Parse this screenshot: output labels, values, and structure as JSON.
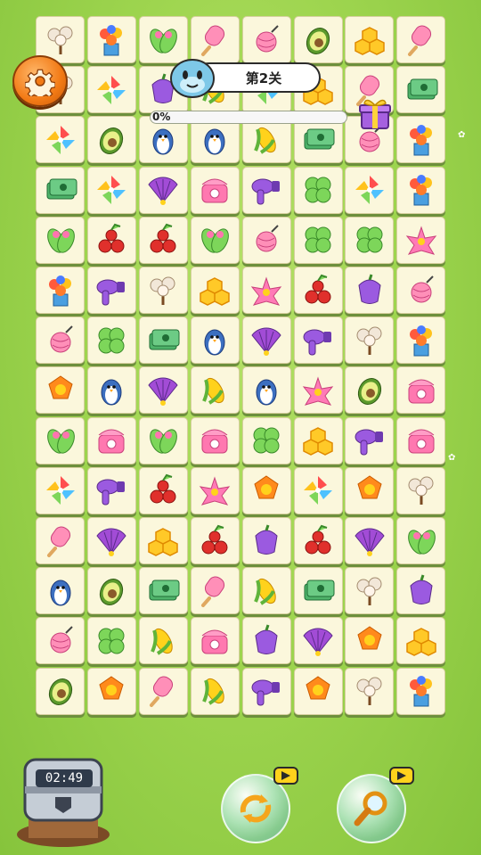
{
  "level": {
    "label": "第2关"
  },
  "progress": {
    "text": "0%",
    "value": 0
  },
  "timer": {
    "text": "02:49"
  },
  "powerups": [
    {
      "name": "shuffle",
      "video_ad": true
    },
    {
      "name": "hint-search",
      "video_ad": true
    }
  ],
  "board": {
    "rows": 14,
    "cols": 8,
    "tiles": [
      [
        "cotton",
        "flower-pot",
        "sandals",
        "popsicle",
        "yarn",
        "avocado",
        "honeycomb",
        "popsicle"
      ],
      [
        "cotton",
        "pinwheel",
        "bellflower",
        "corn",
        "pinwheel",
        "honeycomb",
        "popsicle",
        "banknotes"
      ],
      [
        "pinwheel",
        "avocado",
        "penguin",
        "penguin",
        "corn",
        "banknotes",
        "yarn",
        "flower-pot"
      ],
      [
        "banknotes",
        "pinwheel",
        "fan",
        "telephone",
        "hairdryer",
        "clover",
        "pinwheel",
        "flower-pot"
      ],
      [
        "sandals",
        "cherries",
        "cherries",
        "sandals",
        "yarn",
        "clover",
        "clover",
        "lotus"
      ],
      [
        "flower-pot",
        "hairdryer",
        "cotton",
        "honeycomb",
        "lotus",
        "cherries",
        "bellflower",
        "yarn"
      ],
      [
        "yarn",
        "clover",
        "banknotes",
        "penguin",
        "fan",
        "hairdryer",
        "cotton",
        "flower-pot"
      ],
      [
        "orange-flower",
        "penguin",
        "fan",
        "corn",
        "penguin",
        "lotus",
        "avocado",
        "telephone"
      ],
      [
        "sandals",
        "telephone",
        "sandals",
        "telephone",
        "clover",
        "honeycomb",
        "hairdryer",
        "telephone"
      ],
      [
        "pinwheel",
        "hairdryer",
        "cherries",
        "lotus",
        "orange-flower",
        "pinwheel",
        "orange-flower",
        "cotton"
      ],
      [
        "popsicle",
        "fan",
        "honeycomb",
        "cherries",
        "bellflower",
        "cherries",
        "fan",
        "sandals"
      ],
      [
        "penguin",
        "avocado",
        "banknotes",
        "popsicle",
        "corn",
        "banknotes",
        "cotton",
        "bellflower"
      ],
      [
        "yarn",
        "clover",
        "corn",
        "telephone",
        "bellflower",
        "fan",
        "orange-flower",
        "honeycomb"
      ],
      [
        "avocado",
        "orange-flower",
        "popsicle",
        "corn",
        "hairdryer",
        "orange-flower",
        "cotton",
        "flower-pot"
      ]
    ]
  },
  "colors": {
    "grass": "#9ed54f",
    "tile": "#fbf7dc",
    "settings": "#f27a15",
    "progress": "#5fc24a"
  }
}
